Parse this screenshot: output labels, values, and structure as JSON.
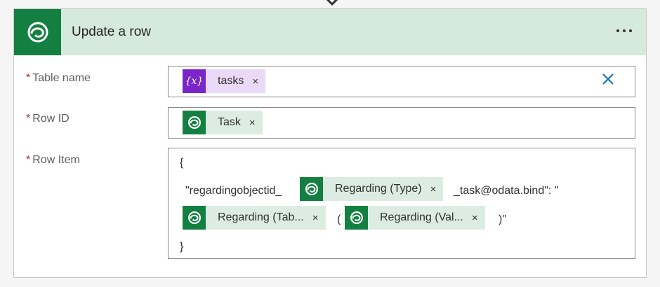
{
  "card": {
    "title": "Update a row",
    "more_options_icon": "more-options-icon",
    "connector_icon": "chevron-down-icon",
    "accent_color": "#138042",
    "header_bg": "#d5e9dd"
  },
  "fields": {
    "required_mark": "*",
    "table_name": {
      "label": "Table name",
      "token": {
        "icon": "variable-icon",
        "icon_text": "{x}",
        "label": "tasks",
        "remove": "×"
      },
      "clear_icon": "clear-icon"
    },
    "row_id": {
      "label": "Row ID",
      "token": {
        "icon": "dataverse-icon",
        "label": "Task",
        "remove": "×"
      }
    },
    "row_item": {
      "label": "Row Item",
      "open_brace": "{",
      "text_prefix": "\"regardingobjectid_",
      "token_type": {
        "icon": "dataverse-icon",
        "label": "Regarding (Type)",
        "remove": "×"
      },
      "text_suffix": "_task@odata.bind\": \"",
      "token_table": {
        "icon": "dataverse-icon",
        "label": "Regarding (Tab...",
        "remove": "×"
      },
      "open_paren": "(",
      "token_value": {
        "icon": "dataverse-icon",
        "label": "Regarding (Val...",
        "remove": "×"
      },
      "close_paren_quote": ")\"",
      "close_brace": "}"
    }
  }
}
